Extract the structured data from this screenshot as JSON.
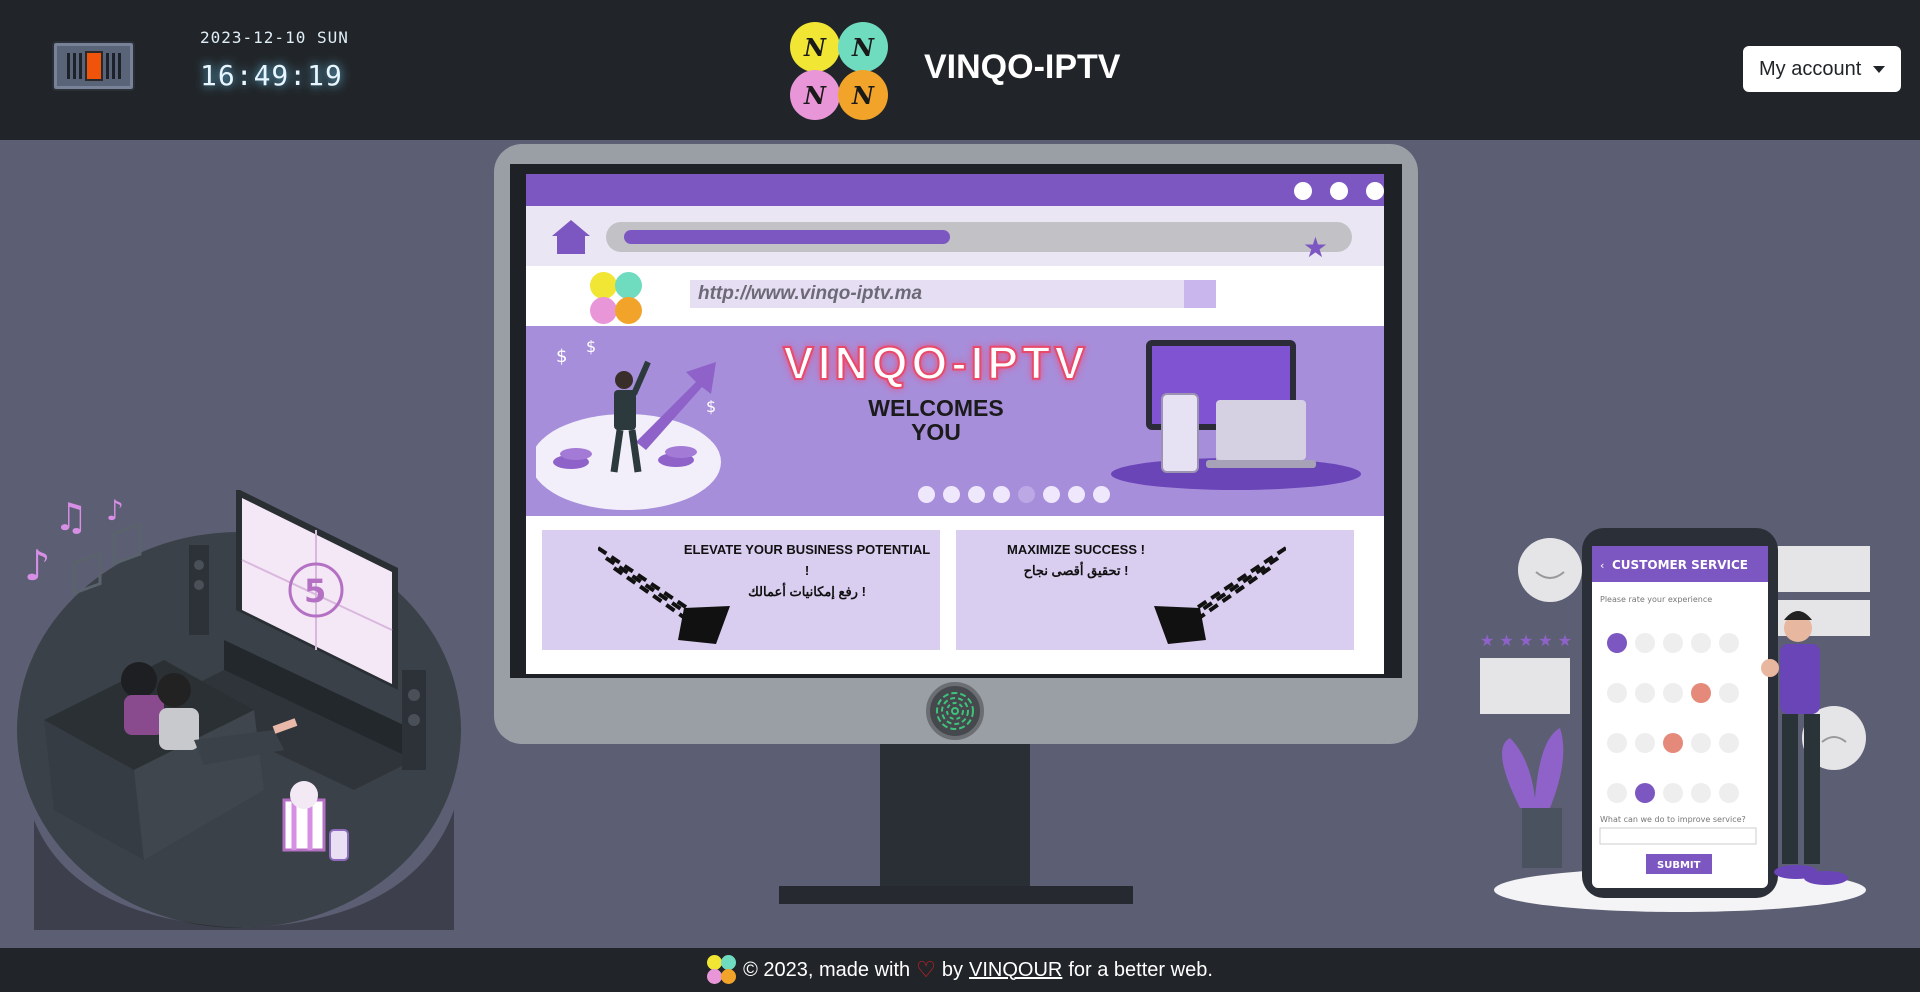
{
  "header": {
    "date": "2023-12-10 SUN",
    "time": "16:49:19",
    "brand": "VINQO-IPTV",
    "account_label": "My account"
  },
  "monitor": {
    "url_text": "http://www.vinqo-iptv.ma",
    "banner_title": "VINQO-IPTV",
    "banner_subtitle_line1": "WELCOMES",
    "banner_subtitle_line2": "YOU",
    "carousel": {
      "total": 8,
      "active": 5
    },
    "card1": {
      "en": "ELEVATE YOUR BUSINESS POTENTIAL !",
      "ar": "رفع إمكانيات أعمالك !"
    },
    "card2": {
      "en": "MAXIMIZE SUCCESS !",
      "ar": "تحقيق أقصى نجاح !"
    }
  },
  "left_illustration": {
    "countdown": "5"
  },
  "right_illustration": {
    "header": "CUSTOMER SERVICE",
    "prompt": "Please rate your experience",
    "question": "What can we do to improve service?",
    "submit": "SUBMIT"
  },
  "footer": {
    "prefix": "© 2023, made with",
    "by": "by",
    "author": "VINQOUR",
    "suffix": "for a better web."
  },
  "colors": {
    "header_bg": "#212529",
    "page_bg": "#5c5f73",
    "accent_purple": "#7c57c2",
    "toggle_knob": "#f0540b"
  }
}
